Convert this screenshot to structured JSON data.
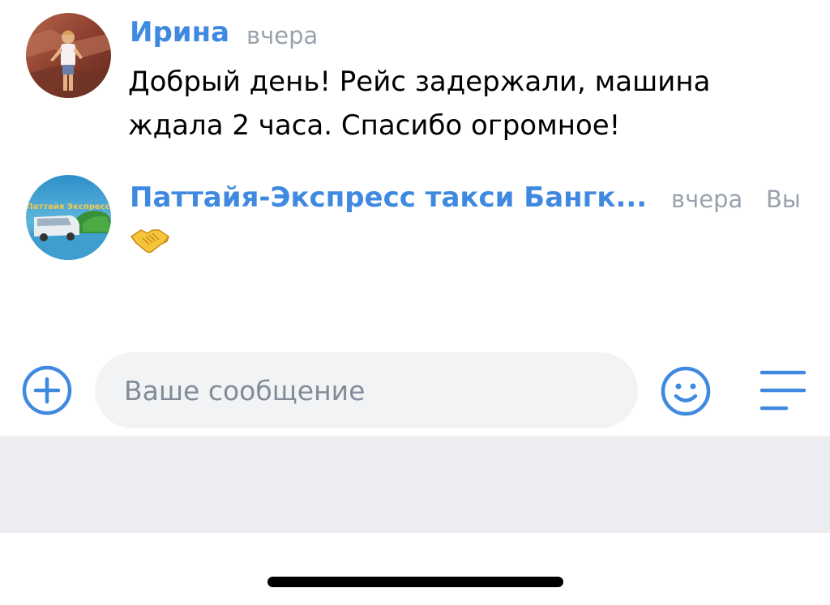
{
  "messages": [
    {
      "author": "Ирина",
      "time": "вчера",
      "text": "Добрый день! Рейс задержали, машина ждала 2 часа. Спасибо огромное!",
      "avatar_icon": "user-photo"
    },
    {
      "author": "Паттайя-Экспресс такси Бангк...",
      "time": "вчера",
      "status": "Вы",
      "text": "",
      "emoji": "handshake-emoji",
      "avatar_logo_text": "Паттайя Экспресс"
    }
  ],
  "composer": {
    "placeholder": "Ваше сообщение",
    "add_icon": "plus-circle-icon",
    "emoji_icon": "smile-icon",
    "menu_icon": "menu-lines-icon"
  },
  "colors": {
    "accent": "#3f8ae0",
    "secondary_text": "#99a2ad",
    "input_bg": "#f2f3f5",
    "panel_bg": "#ebedf0"
  }
}
